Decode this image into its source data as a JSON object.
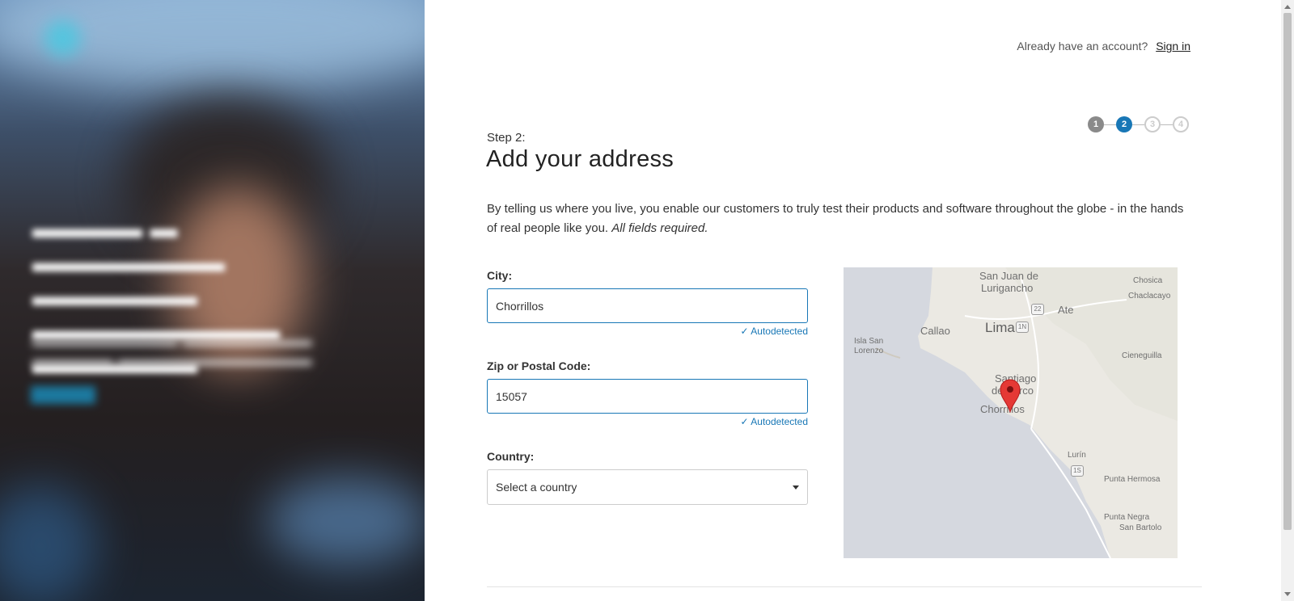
{
  "header": {
    "account_prompt": "Already have an account?",
    "signin_label": "Sign in"
  },
  "steps": {
    "items": [
      "1",
      "2",
      "3",
      "4"
    ],
    "current": 2,
    "colors": {
      "done": "#8a8a8a",
      "active": "#1877b6",
      "todo": "#cccccc"
    }
  },
  "page": {
    "step_label": "Step 2:",
    "title": "Add your address",
    "description": "By telling us where you live, you enable our customers to truly test their products and software throughout the globe - in the hands of real people like you.",
    "required_note": "All fields required."
  },
  "form": {
    "city_label": "City:",
    "city_value": "Chorrillos",
    "city_status": "Autodetected",
    "zip_label": "Zip or Postal Code:",
    "zip_value": "15057",
    "zip_status": "Autodetected",
    "country_label": "Country:",
    "country_placeholder": "Select a country"
  },
  "map": {
    "places": {
      "san_juan_1": "San Juan de",
      "san_juan_2": "Lurigancho",
      "chosica": "Chosica",
      "chaclacayo": "Chaclacayo",
      "ate": "Ate",
      "callao": "Callao",
      "lima": "Lima",
      "isla_1": "Isla San",
      "isla_2": "Lorenzo",
      "cieneguilla": "Cieneguilla",
      "santiago_1": "Santiago",
      "santiago_2": "de Surco",
      "chorrillos": "Chorrillos",
      "lurin": "Lurín",
      "punta_hermosa": "Punta Hermosa",
      "punta_negra_1": "Punta Negra",
      "punta_negra_2": "San Bartolo"
    },
    "route_shields": {
      "r22": "22",
      "r1n": "1N",
      "r1s": "1S"
    },
    "marker_color": "#e53935"
  },
  "colors": {
    "accent": "#1877b6"
  }
}
